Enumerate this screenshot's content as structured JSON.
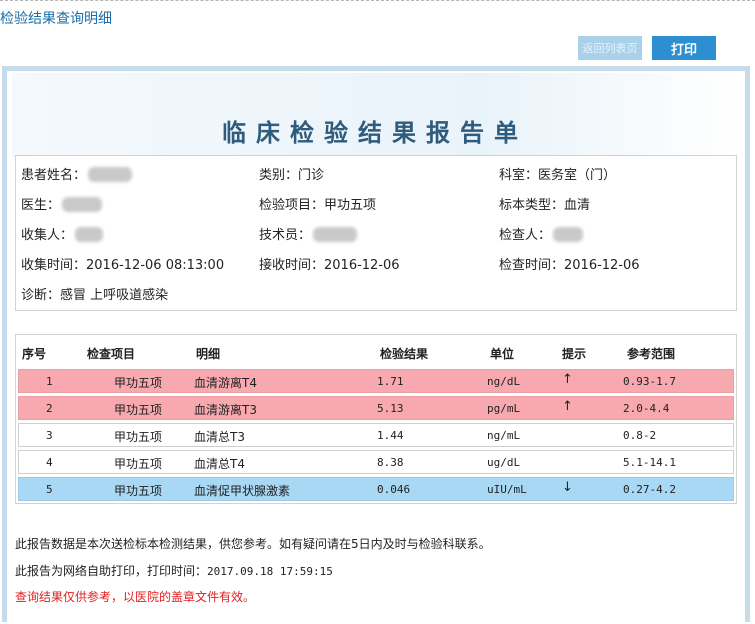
{
  "page": {
    "heading": "检验结果查询明细"
  },
  "toolbar": {
    "back_label": "返回列表页",
    "print_label": "打印"
  },
  "report": {
    "title": "临床检验结果报告单"
  },
  "patient": {
    "name_label": "患者姓名：",
    "category_label": "类别：",
    "category_value": "门诊",
    "department_label": "科室：",
    "department_value": "医务室（门）",
    "doctor_label": "医生：",
    "test_item_label": "检验项目：",
    "test_item_value": "甲功五项",
    "sample_type_label": "标本类型：",
    "sample_type_value": "血清",
    "collector_label": "收集人：",
    "technician_label": "技术员：",
    "examiner_label": "检查人：",
    "collect_time_label": "收集时间：",
    "collect_time_value": "2016-12-06 08:13:00",
    "receive_time_label": "接收时间：",
    "receive_time_value": "2016-12-06",
    "exam_time_label": "检查时间：",
    "exam_time_value": "2016-12-06",
    "diagnosis_label": "诊断：",
    "diagnosis_value": "感冒 上呼吸道感染"
  },
  "results_table": {
    "headers": {
      "no": "序号",
      "item": "检查项目",
      "detail": "明细",
      "result": "检验结果",
      "unit": "单位",
      "hint": "提示",
      "range": "参考范围"
    },
    "rows": [
      {
        "no": "1",
        "item": "甲功五项",
        "detail": "血清游离T4",
        "result": "1.71",
        "unit": "ng/dL",
        "hint": "↑",
        "range": "0.93-1.7",
        "status": "high"
      },
      {
        "no": "2",
        "item": "甲功五项",
        "detail": "血清游离T3",
        "result": "5.13",
        "unit": "pg/mL",
        "hint": "↑",
        "range": "2.0-4.4",
        "status": "high"
      },
      {
        "no": "3",
        "item": "甲功五项",
        "detail": "血清总T3",
        "result": "1.44",
        "unit": "ng/mL",
        "hint": "",
        "range": "0.8-2",
        "status": "normal"
      },
      {
        "no": "4",
        "item": "甲功五项",
        "detail": "血清总T4",
        "result": "8.38",
        "unit": "ug/dL",
        "hint": "",
        "range": "5.1-14.1",
        "status": "normal"
      },
      {
        "no": "5",
        "item": "甲功五项",
        "detail": "血清促甲状腺激素",
        "result": "0.046",
        "unit": "uIU/mL",
        "hint": "↓",
        "range": "0.27-4.2",
        "status": "low"
      }
    ]
  },
  "footer": {
    "note1": "此报告数据是本次送检标本检测结果，供您参考。如有疑问请在5日内及时与检验科联系。",
    "note2_prefix": "此报告为网络自助打印，打印时间：",
    "print_time": "2017.09.18 17:59:15",
    "note3": "查询结果仅供参考，以医院的盖章文件有效。"
  }
}
